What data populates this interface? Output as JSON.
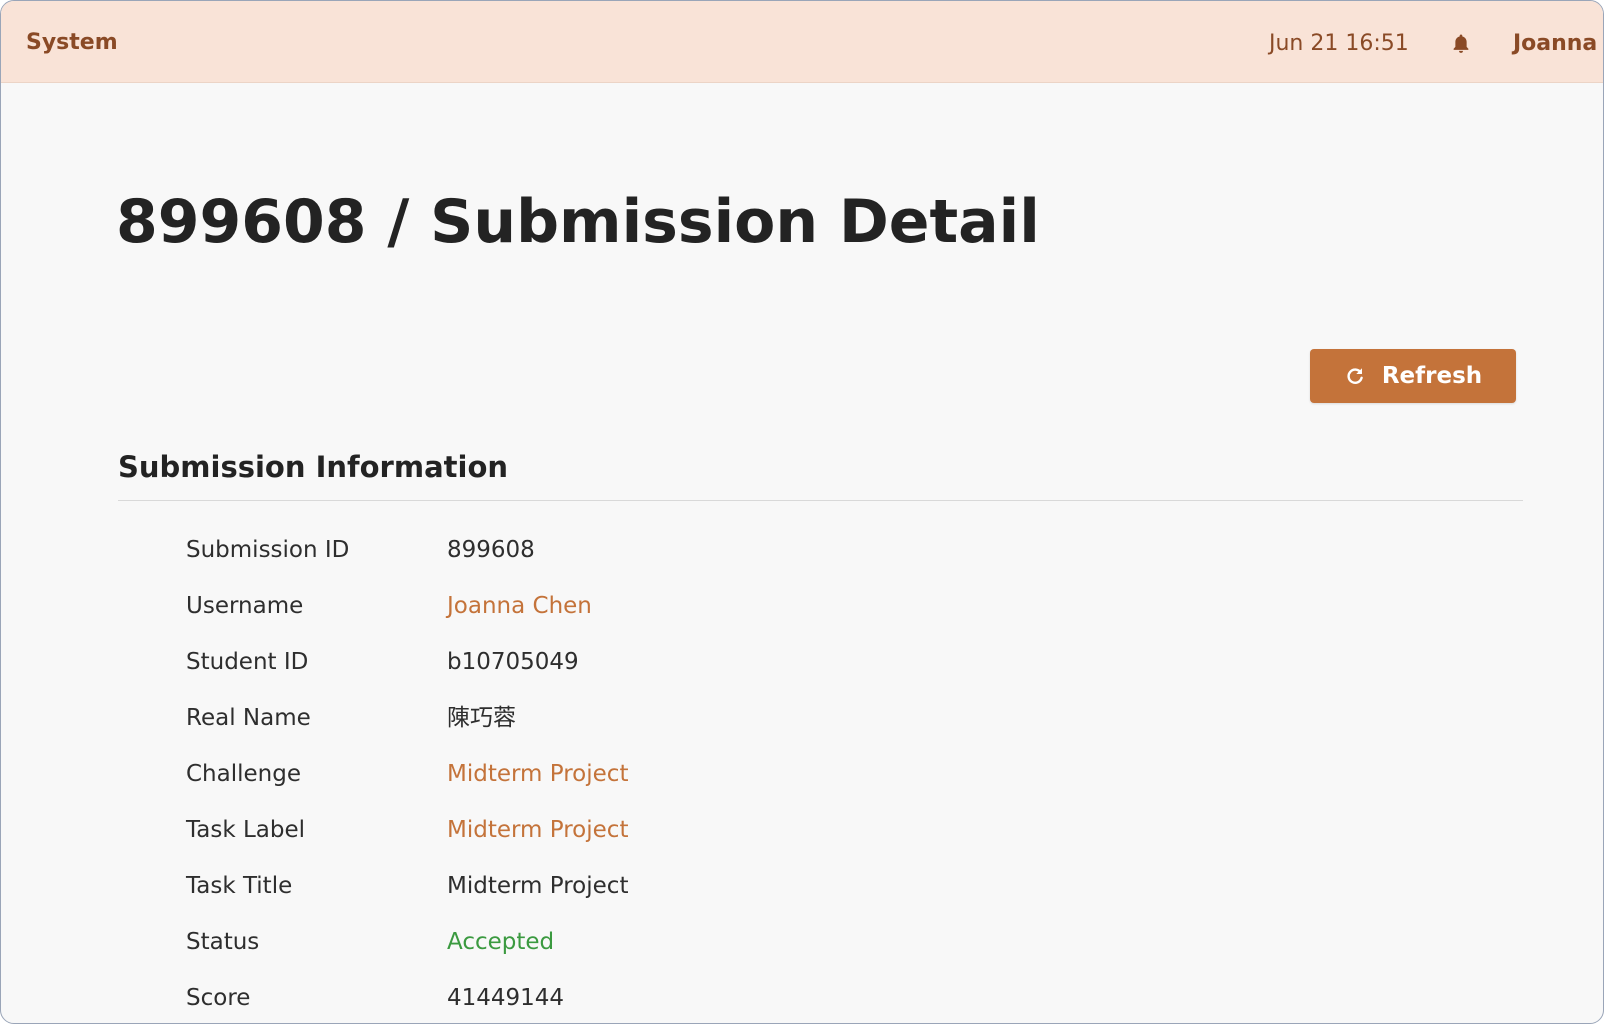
{
  "topbar": {
    "brand": "System",
    "datetime": "Jun 21 16:51",
    "bell_icon": "bell-icon",
    "user_name": "Joanna Chen"
  },
  "page": {
    "title": "899608 / Submission Detail"
  },
  "toolbar": {
    "refresh_label": "Refresh",
    "refresh_icon": "refresh-icon"
  },
  "section": {
    "title": "Submission Information"
  },
  "info": {
    "rows": [
      {
        "label": "Submission ID",
        "value": "899608"
      },
      {
        "label": "Username",
        "value": "Joanna Chen"
      },
      {
        "label": "Student ID",
        "value": "b10705049"
      },
      {
        "label": "Real Name",
        "value": "陳巧蓉"
      },
      {
        "label": "Challenge",
        "value": "Midterm Project"
      },
      {
        "label": "Task Label",
        "value": "Midterm Project"
      },
      {
        "label": "Task Title",
        "value": "Midterm Project"
      },
      {
        "label": "Status",
        "value": "Accepted"
      },
      {
        "label": "Score",
        "value": "41449144"
      }
    ]
  },
  "colors": {
    "topbar_bg": "#f9e3d7",
    "brand_text": "#8a4a26",
    "accent": "#c4733a",
    "status_accepted": "#3b9a40",
    "page_bg": "#f8f8f8"
  }
}
